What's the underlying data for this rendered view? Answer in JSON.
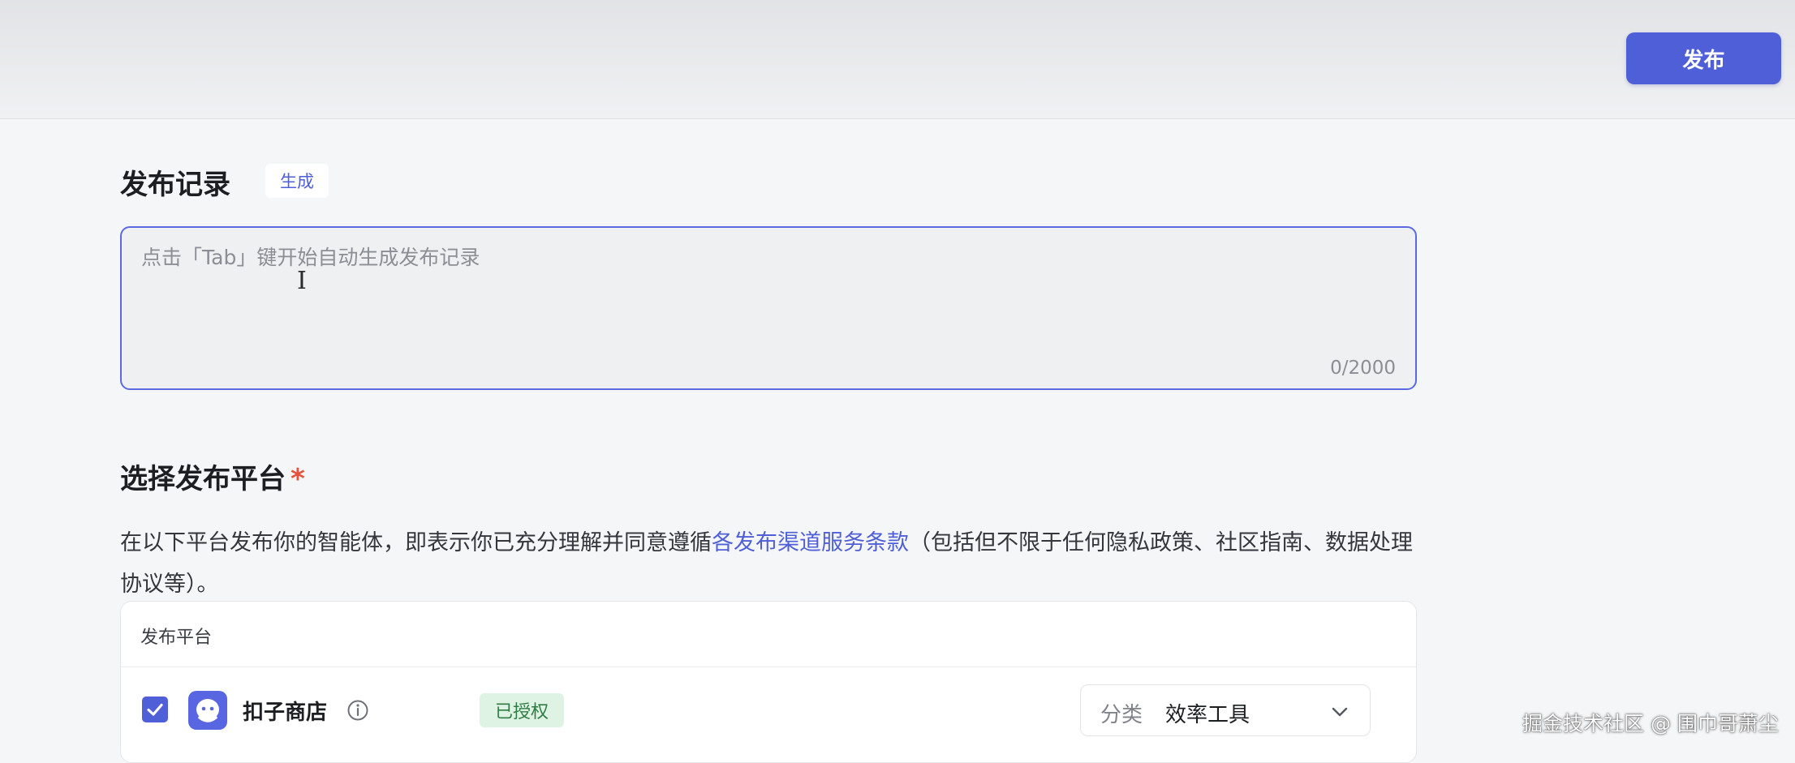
{
  "header": {
    "publish_button": "发布"
  },
  "release_notes": {
    "title": "发布记录",
    "generate_chip": "生成",
    "placeholder": "点击「Tab」键开始自动生成发布记录",
    "counter": "0/2000"
  },
  "platform_section": {
    "title": "选择发布平台",
    "required_mark": "*",
    "description_before": "在以下平台发布你的智能体，即表示你已充分理解并同意遵循",
    "description_link": "各发布渠道服务条款",
    "description_after": "（包括但不限于任何隐私政策、社区指南、数据处理协议等）。",
    "table_header": "发布平台",
    "platforms": [
      {
        "name": "扣子商店",
        "checked": true,
        "status": "已授权",
        "category_label": "分类",
        "category_value": "效率工具",
        "icon": "kouzi-store-logo-icon"
      }
    ]
  },
  "watermark": "掘金技术社区 @ 围巾哥萧尘",
  "colors": {
    "accent": "#4f5fd8",
    "required": "#e5533d",
    "authorized_bg": "#def3e3",
    "authorized_text": "#2f7d45"
  }
}
